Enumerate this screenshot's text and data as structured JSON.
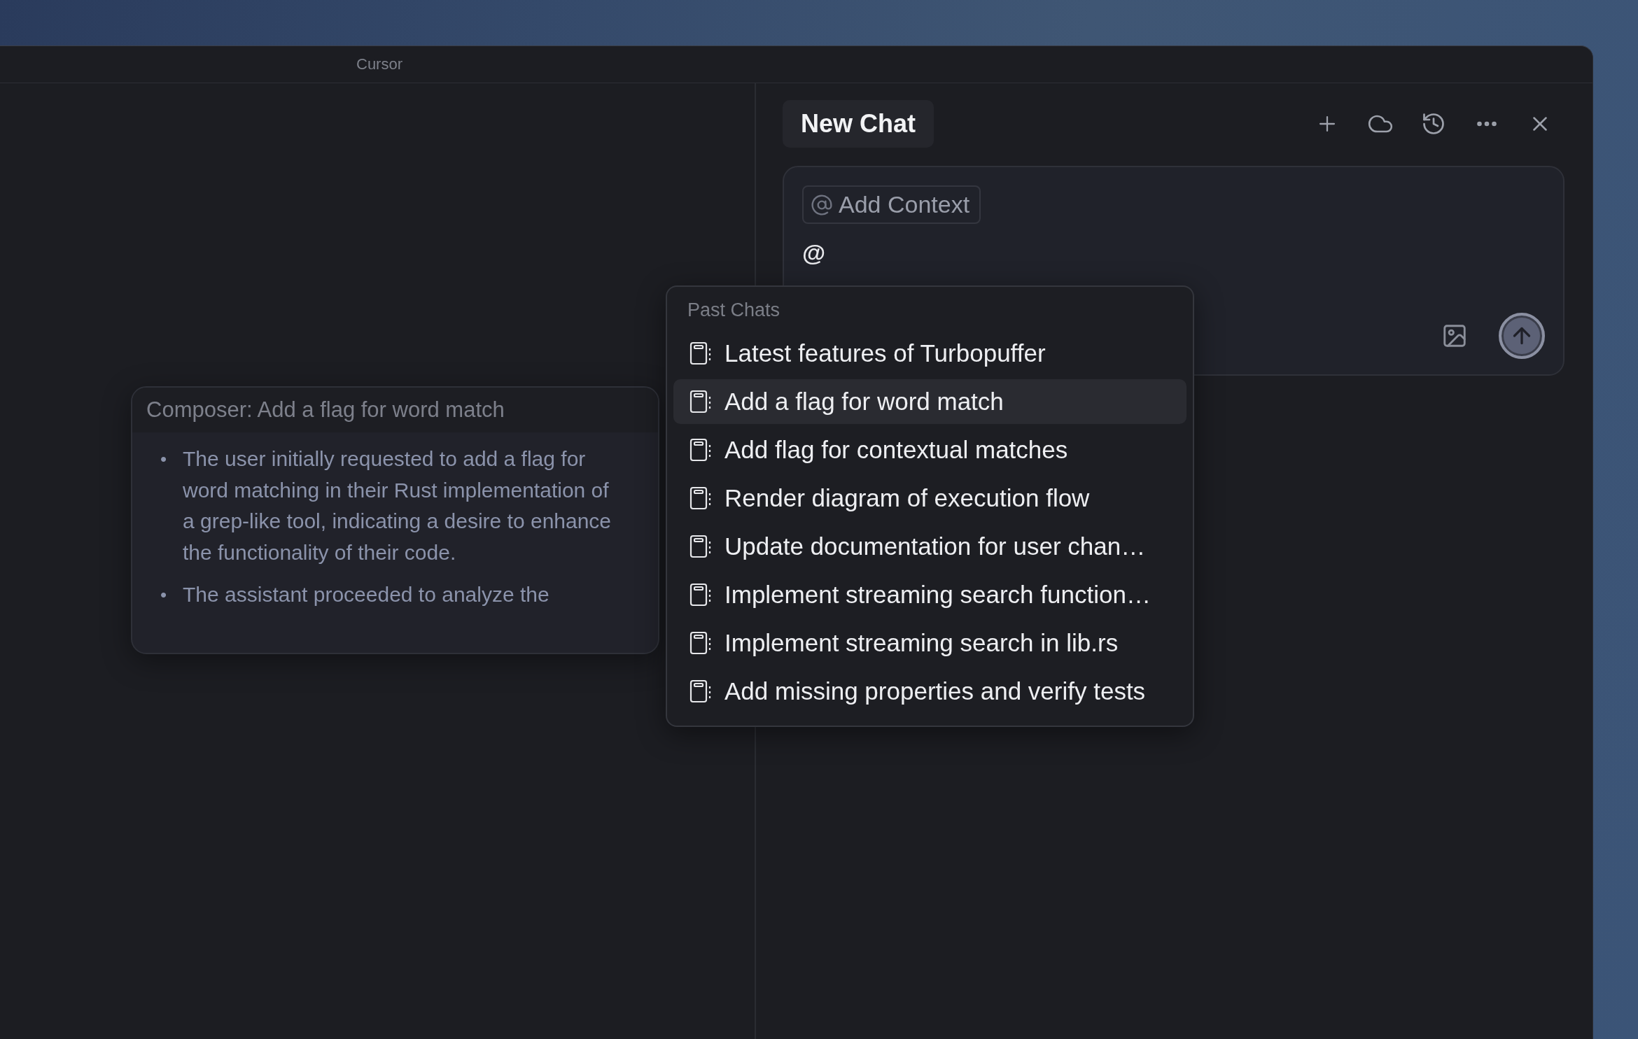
{
  "window": {
    "title": "Cursor"
  },
  "chat_panel": {
    "tab": "New Chat",
    "context_chip": "Add Context",
    "input_value": "@"
  },
  "past_chats": {
    "heading": "Past Chats",
    "items": [
      {
        "title": "Latest features of Turbopuffer",
        "selected": false
      },
      {
        "title": "Add a flag for word match",
        "selected": true
      },
      {
        "title": "Add flag for contextual matches",
        "selected": false
      },
      {
        "title": "Render diagram of execution flow",
        "selected": false
      },
      {
        "title": "Update documentation for user chan…",
        "selected": false
      },
      {
        "title": "Implement streaming search function…",
        "selected": false
      },
      {
        "title": "Implement streaming search in lib.rs",
        "selected": false
      },
      {
        "title": "Add missing properties and verify tests",
        "selected": false
      }
    ]
  },
  "hover_card": {
    "title": "Composer: Add a flag for word match",
    "bullets": [
      {
        "marker": "•",
        "text": "The user initially requested to add a flag for word matching in their Rust implementation of a grep-like tool, indicating a desire to enhance the functionality of their code."
      },
      {
        "marker": "•",
        "text": "The assistant proceeded to analyze the"
      }
    ]
  }
}
